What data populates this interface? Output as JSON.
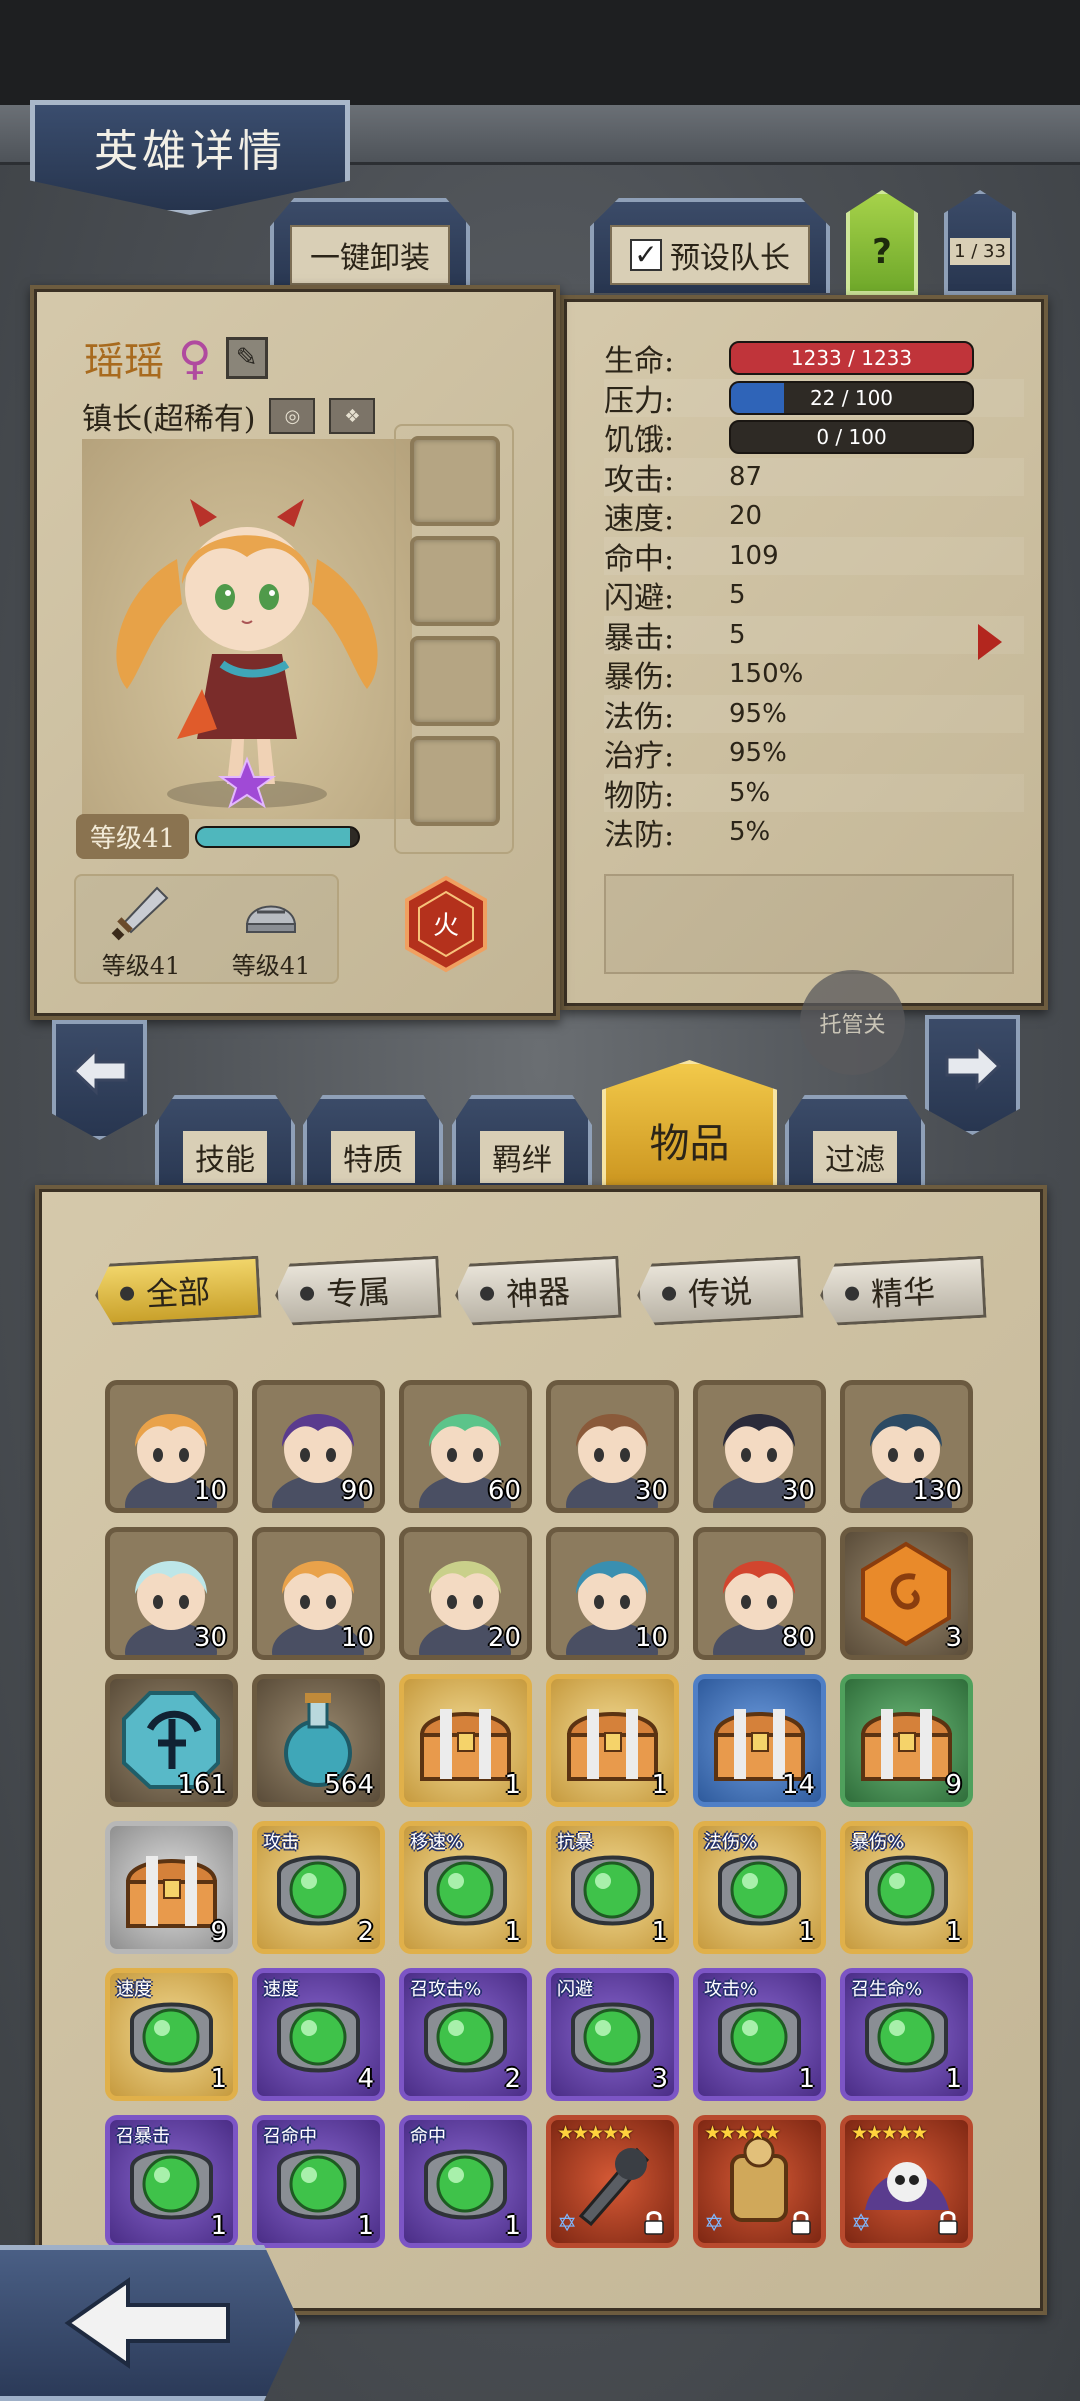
{
  "header": {
    "title": "英雄详情"
  },
  "top_tabs": {
    "unequip": "一键卸装",
    "preset_captain": "预设队长",
    "preset_checked": "✓",
    "help": "?",
    "count": "1 / 33"
  },
  "hero": {
    "name": "瑶瑶",
    "title": "镇长(超稀有)",
    "level_label": "等级41",
    "xp_fraction": 0.95,
    "weapon_level": "等级41",
    "armor_level": "等级41",
    "element": "火"
  },
  "stats": [
    {
      "label": "生命:",
      "value": "1233 / 1233",
      "bar": "red",
      "fill": 1.0
    },
    {
      "label": "压力:",
      "value": "22 / 100",
      "bar": "blue",
      "fill": 0.22
    },
    {
      "label": "饥饿:",
      "value": "0 / 100",
      "bar": "dark",
      "fill": 0.0
    },
    {
      "label": "攻击:",
      "value": "87"
    },
    {
      "label": "速度:",
      "value": "20"
    },
    {
      "label": "命中:",
      "value": "109"
    },
    {
      "label": "闪避:",
      "value": "5"
    },
    {
      "label": "暴击:",
      "value": "5"
    },
    {
      "label": "暴伤:",
      "value": "150%"
    },
    {
      "label": "法伤:",
      "value": "95%"
    },
    {
      "label": "治疗:",
      "value": "95%"
    },
    {
      "label": "物防:",
      "value": "5%"
    },
    {
      "label": "法防:",
      "value": "5%"
    }
  ],
  "auto_button": "托管关",
  "category_tabs": [
    "技能",
    "特质",
    "羁绊",
    "物品",
    "过滤"
  ],
  "active_category": "物品",
  "filters": [
    "全部",
    "专属",
    "神器",
    "传说",
    "精华"
  ],
  "active_filter": "全部",
  "items": [
    {
      "kind": "hero",
      "qty": "10",
      "hair": "#e9a24a"
    },
    {
      "kind": "hero",
      "qty": "90",
      "hair": "#5a3b8e"
    },
    {
      "kind": "hero",
      "qty": "60",
      "hair": "#5cc48a"
    },
    {
      "kind": "hero",
      "qty": "30",
      "hair": "#8a5a3a"
    },
    {
      "kind": "hero",
      "qty": "30",
      "hair": "#2b2b3a"
    },
    {
      "kind": "hero",
      "qty": "130",
      "hair": "#2c4a63"
    },
    {
      "kind": "hero",
      "qty": "30",
      "hair": "#bde6e8"
    },
    {
      "kind": "hero",
      "qty": "10",
      "hair": "#e9a24a"
    },
    {
      "kind": "hero",
      "qty": "20",
      "hair": "#c9d08a"
    },
    {
      "kind": "hero",
      "qty": "10",
      "hair": "#3a8fb0"
    },
    {
      "kind": "hero",
      "qty": "80",
      "hair": "#d2452e"
    },
    {
      "kind": "gem-orange",
      "qty": "3"
    },
    {
      "kind": "rune-cyan",
      "qty": "161"
    },
    {
      "kind": "potion",
      "qty": "564"
    },
    {
      "kind": "chest",
      "rarity": "gold",
      "qty": "1"
    },
    {
      "kind": "chest",
      "rarity": "gold",
      "qty": "1"
    },
    {
      "kind": "chest",
      "rarity": "blue",
      "qty": "14"
    },
    {
      "kind": "chest",
      "rarity": "green",
      "qty": "9"
    },
    {
      "kind": "chest",
      "rarity": "silver",
      "qty": "9"
    },
    {
      "kind": "orb",
      "rarity": "gold",
      "tag": "攻击",
      "qty": "2"
    },
    {
      "kind": "orb",
      "rarity": "gold",
      "tag": "移速%",
      "qty": "1"
    },
    {
      "kind": "orb",
      "rarity": "gold",
      "tag": "抗暴",
      "qty": "1"
    },
    {
      "kind": "orb",
      "rarity": "gold",
      "tag": "法伤%",
      "qty": "1"
    },
    {
      "kind": "orb",
      "rarity": "gold",
      "tag": "暴伤%",
      "qty": "1"
    },
    {
      "kind": "orb",
      "rarity": "gold",
      "tag": "速度",
      "qty": "1"
    },
    {
      "kind": "orb",
      "rarity": "purple",
      "tag": "速度",
      "qty": "4"
    },
    {
      "kind": "orb",
      "rarity": "purple",
      "tag": "召攻击%",
      "qty": "2"
    },
    {
      "kind": "orb",
      "rarity": "purple",
      "tag": "闪避",
      "qty": "3"
    },
    {
      "kind": "orb",
      "rarity": "purple",
      "tag": "攻击%",
      "qty": "1"
    },
    {
      "kind": "orb",
      "rarity": "purple",
      "tag": "召生命%",
      "qty": "1"
    },
    {
      "kind": "orb",
      "rarity": "purple",
      "tag": "召暴击",
      "qty": "1"
    },
    {
      "kind": "orb",
      "rarity": "purple",
      "tag": "召命中",
      "qty": "1"
    },
    {
      "kind": "orb",
      "rarity": "purple",
      "tag": "命中",
      "qty": "1"
    },
    {
      "kind": "artifact",
      "stars": "★★★★★",
      "art": "weapon"
    },
    {
      "kind": "artifact",
      "stars": "★★★★★",
      "art": "armor"
    },
    {
      "kind": "artifact",
      "stars": "★★★★★",
      "art": "skull"
    }
  ],
  "colors": {
    "hp_bar": "#c0343a",
    "stress_bar": "#2f64b8",
    "accent_gold": "#e0b04a",
    "panel_paper": "#cfc19f"
  }
}
